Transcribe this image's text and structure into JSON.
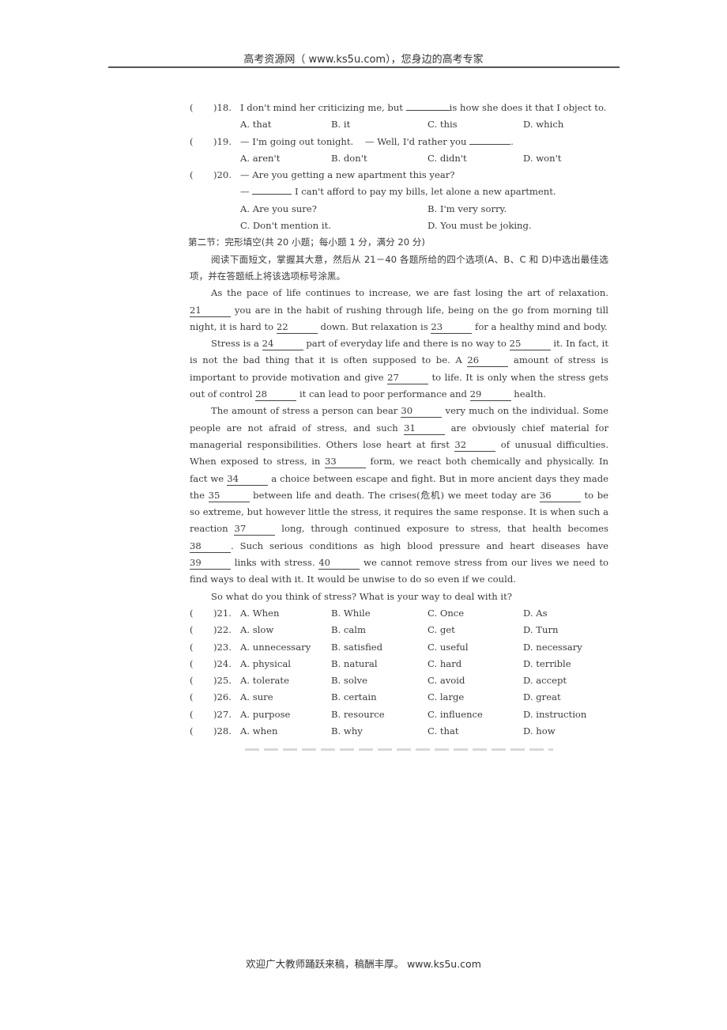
{
  "header": {
    "text": "高考资源网（ www.ks5u.com），您身边的高考专家"
  },
  "mc_questions": [
    {
      "paren": "(",
      "num": ")18.",
      "stem": "I don't mind her criticizing me, but ",
      "blank": "",
      "stem_after": "is how she does it that I object to.",
      "options": [
        "A.  that",
        "B.  it",
        "C.  this",
        "D.  which"
      ]
    },
    {
      "paren": "(",
      "num": ")19.",
      "stem": "— I'm going out tonight.    — Well, I'd rather you ",
      "blank": "",
      "stem_after": ".",
      "options": [
        "A.  aren't",
        "B.  don't",
        "C.  didn't",
        "D.  won't"
      ]
    },
    {
      "paren": "(",
      "num": ")20.",
      "stem": "— Are you getting a new apartment this year?",
      "line2_prefix": "— ",
      "line2_after": " I can't afford to pay my bills, let alone a new apartment.",
      "options": [
        "A.  Are you sure?",
        "B.  I'm very sorry.",
        "C.  Don't mention it.",
        "D.  You must be joking."
      ]
    }
  ],
  "section2": {
    "title": "第二节：完形填空(共 20 小题；每小题 1 分，满分 20 分)",
    "instructions": "阅读下面短文，掌握其大意，然后从 21－40 各题所给的四个选项(A、B、C 和 D)中选出最佳选项，并在答题纸上将该选项标号涂黑。"
  },
  "passage": {
    "p1": [
      "As the pace of life continues to increase, we are fast losing the art of relaxation. ",
      "21",
      " you are in the habit of rushing through life, being on the go from morning till night, it is hard to ",
      "22",
      " down. But relaxation is ",
      "23",
      " for a healthy mind and body."
    ],
    "p2": [
      "Stress is a ",
      "24",
      " part of everyday life and there is no way to ",
      "25",
      " it. In fact, it is not the bad thing that it is often supposed to be. A ",
      "26",
      " amount of stress is important to provide motivation and give ",
      "27",
      " to life. It is only when the stress gets out of control ",
      "28",
      " it can lead to poor performance and ",
      "29",
      " health."
    ],
    "p3": [
      "The amount of stress a person can bear ",
      "30",
      " very much on the individual. Some people are not afraid of stress, and such ",
      "31",
      " are obviously chief material for managerial responsibilities. Others lose heart at first ",
      "32",
      " of unusual difficulties. When exposed to stress, in ",
      "33",
      " form, we react both chemically and physically. In fact we ",
      "34",
      " a choice between escape and fight. But in more ancient days they made the ",
      "35",
      " between life and death. The crises(危机) we meet today are ",
      "36",
      " to be so extreme, but however little the stress, it requires the same response. It is when such a reaction ",
      "37",
      " long, through continued exposure to stress, that health becomes ",
      "38",
      ". Such serious conditions as high blood pressure and heart diseases have ",
      "39",
      " links with stress. ",
      "40",
      " we cannot remove stress from our lives we need to find ways to deal with it. It would be unwise to do so even if we could."
    ],
    "p4": "So what do you think of stress? What is your way to deal with it?"
  },
  "cloze_options": [
    {
      "paren": "(",
      "num": ")21.",
      "a": "A.  When",
      "b": "B.  While",
      "c": "C.  Once",
      "d": "D.  As"
    },
    {
      "paren": "(",
      "num": ")22.",
      "a": "A.  slow",
      "b": "B.  calm",
      "c": "C.  get",
      "d": "D.  Turn"
    },
    {
      "paren": "(",
      "num": ")23.",
      "a": "A.  unnecessary",
      "b": "B.  satisfied",
      "c": "C.  useful",
      "d": "D.  necessary"
    },
    {
      "paren": "(",
      "num": ")24.",
      "a": "A.  physical",
      "b": "B.  natural",
      "c": "C.  hard",
      "d": "D.  terrible"
    },
    {
      "paren": "(",
      "num": ")25.",
      "a": "A.  tolerate",
      "b": "B.  solve",
      "c": "C.  avoid",
      "d": "D.  accept"
    },
    {
      "paren": "(",
      "num": ")26.",
      "a": "A.  sure",
      "b": "B.  certain",
      "c": "C.  large",
      "d": "D.  great"
    },
    {
      "paren": "(",
      "num": ")27.",
      "a": "A.  purpose",
      "b": "B.  resource",
      "c": "C.  influence",
      "d": "D.  instruction"
    },
    {
      "paren": "(",
      "num": ")28.",
      "a": "A.  when",
      "b": "B.  why",
      "c": "C.  that",
      "d": "D.  how"
    }
  ],
  "footer": {
    "text": "欢迎广大教师踊跃来稿，稿酬丰厚。  www.ks5u.com"
  }
}
